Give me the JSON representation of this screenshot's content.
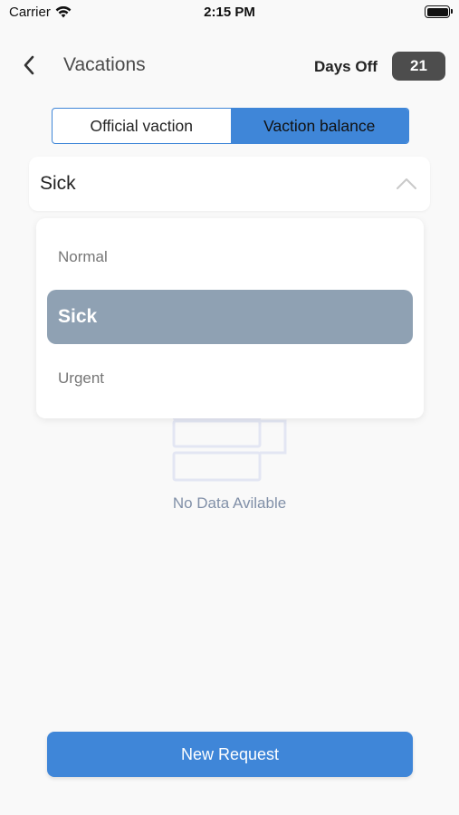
{
  "status_bar": {
    "carrier": "Carrier",
    "time": "2:15 PM",
    "wifi_icon": "wifi-icon",
    "battery_icon": "battery-icon"
  },
  "header": {
    "back_icon": "chevron-left-icon",
    "title": "Vacations",
    "days_off_label": "Days Off",
    "days_off_value": "21"
  },
  "tabs": [
    {
      "label": "Official vaction",
      "active": false
    },
    {
      "label": "Vaction balance",
      "active": true
    }
  ],
  "selector": {
    "value": "Sick",
    "icon": "chevron-up-icon"
  },
  "dropdown": {
    "options": [
      "Normal",
      "Sick",
      "Urgent"
    ],
    "selected": "Sick"
  },
  "empty_state": {
    "icon": "empty-list-icon",
    "text": "No Data Avilable"
  },
  "footer": {
    "new_request_label": "New Request"
  },
  "colors": {
    "accent": "#3f86d8",
    "badge": "#4d4d4d",
    "selected_option": "#8fa1b3",
    "background": "#f9f9f9"
  }
}
